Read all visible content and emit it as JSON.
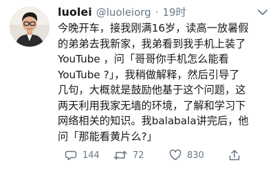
{
  "tweet": {
    "display_name": "luolei",
    "handle": "@luoleiorg",
    "separator": "·",
    "time": "19时",
    "lines": [
      "今晚开车，接我刚满16岁，读高一放暑假",
      "的弟弟去我新家，我弟看到我手机上装了",
      "YouTube ，问「哥哥你手机怎么能看",
      "YouTube ?」，我稍做解释，然后引导了",
      "几句，大概就是鼓励他基于这个问题，这",
      "两天利用我家无墙的环境，了解和学习下",
      "网络相关的知识。我balabala讲完后，他",
      "问「那能看黄片么?」"
    ]
  },
  "actions": {
    "replies": "144",
    "retweets": "72",
    "likes": "830"
  },
  "icons": {
    "avatar": "avatar-photo",
    "menu": "chevron-down-icon",
    "reply": "reply-icon",
    "retweet": "retweet-icon",
    "like": "heart-icon",
    "share": "share-icon"
  },
  "colors": {
    "text": "#14171a",
    "secondary": "#657786"
  }
}
